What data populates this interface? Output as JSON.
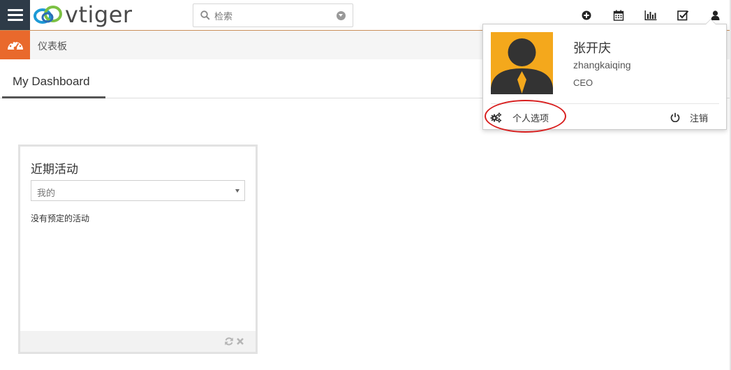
{
  "app": {
    "logo_text": "vtiger"
  },
  "search": {
    "placeholder": "检索"
  },
  "module": {
    "title": "仪表板"
  },
  "tabs": [
    {
      "label": "My Dashboard"
    }
  ],
  "widget": {
    "title": "近期活动",
    "select_value": "我的",
    "empty_message": "没有预定的活动"
  },
  "user": {
    "name": "张开庆",
    "login": "zhangkaiqing",
    "role": "CEO",
    "preferences_label": "个人选项",
    "logout_label": "注销"
  },
  "icons": {
    "top": [
      "add-icon",
      "calendar-icon",
      "reports-icon",
      "tasks-icon",
      "user-icon"
    ],
    "widget_footer": [
      "refresh-icon",
      "close-icon"
    ]
  },
  "colors": {
    "menu_bg": "#2e3b48",
    "module_accent": "#e9692c",
    "avatar_bg": "#f4a81c",
    "highlight": "#d81e1e"
  }
}
